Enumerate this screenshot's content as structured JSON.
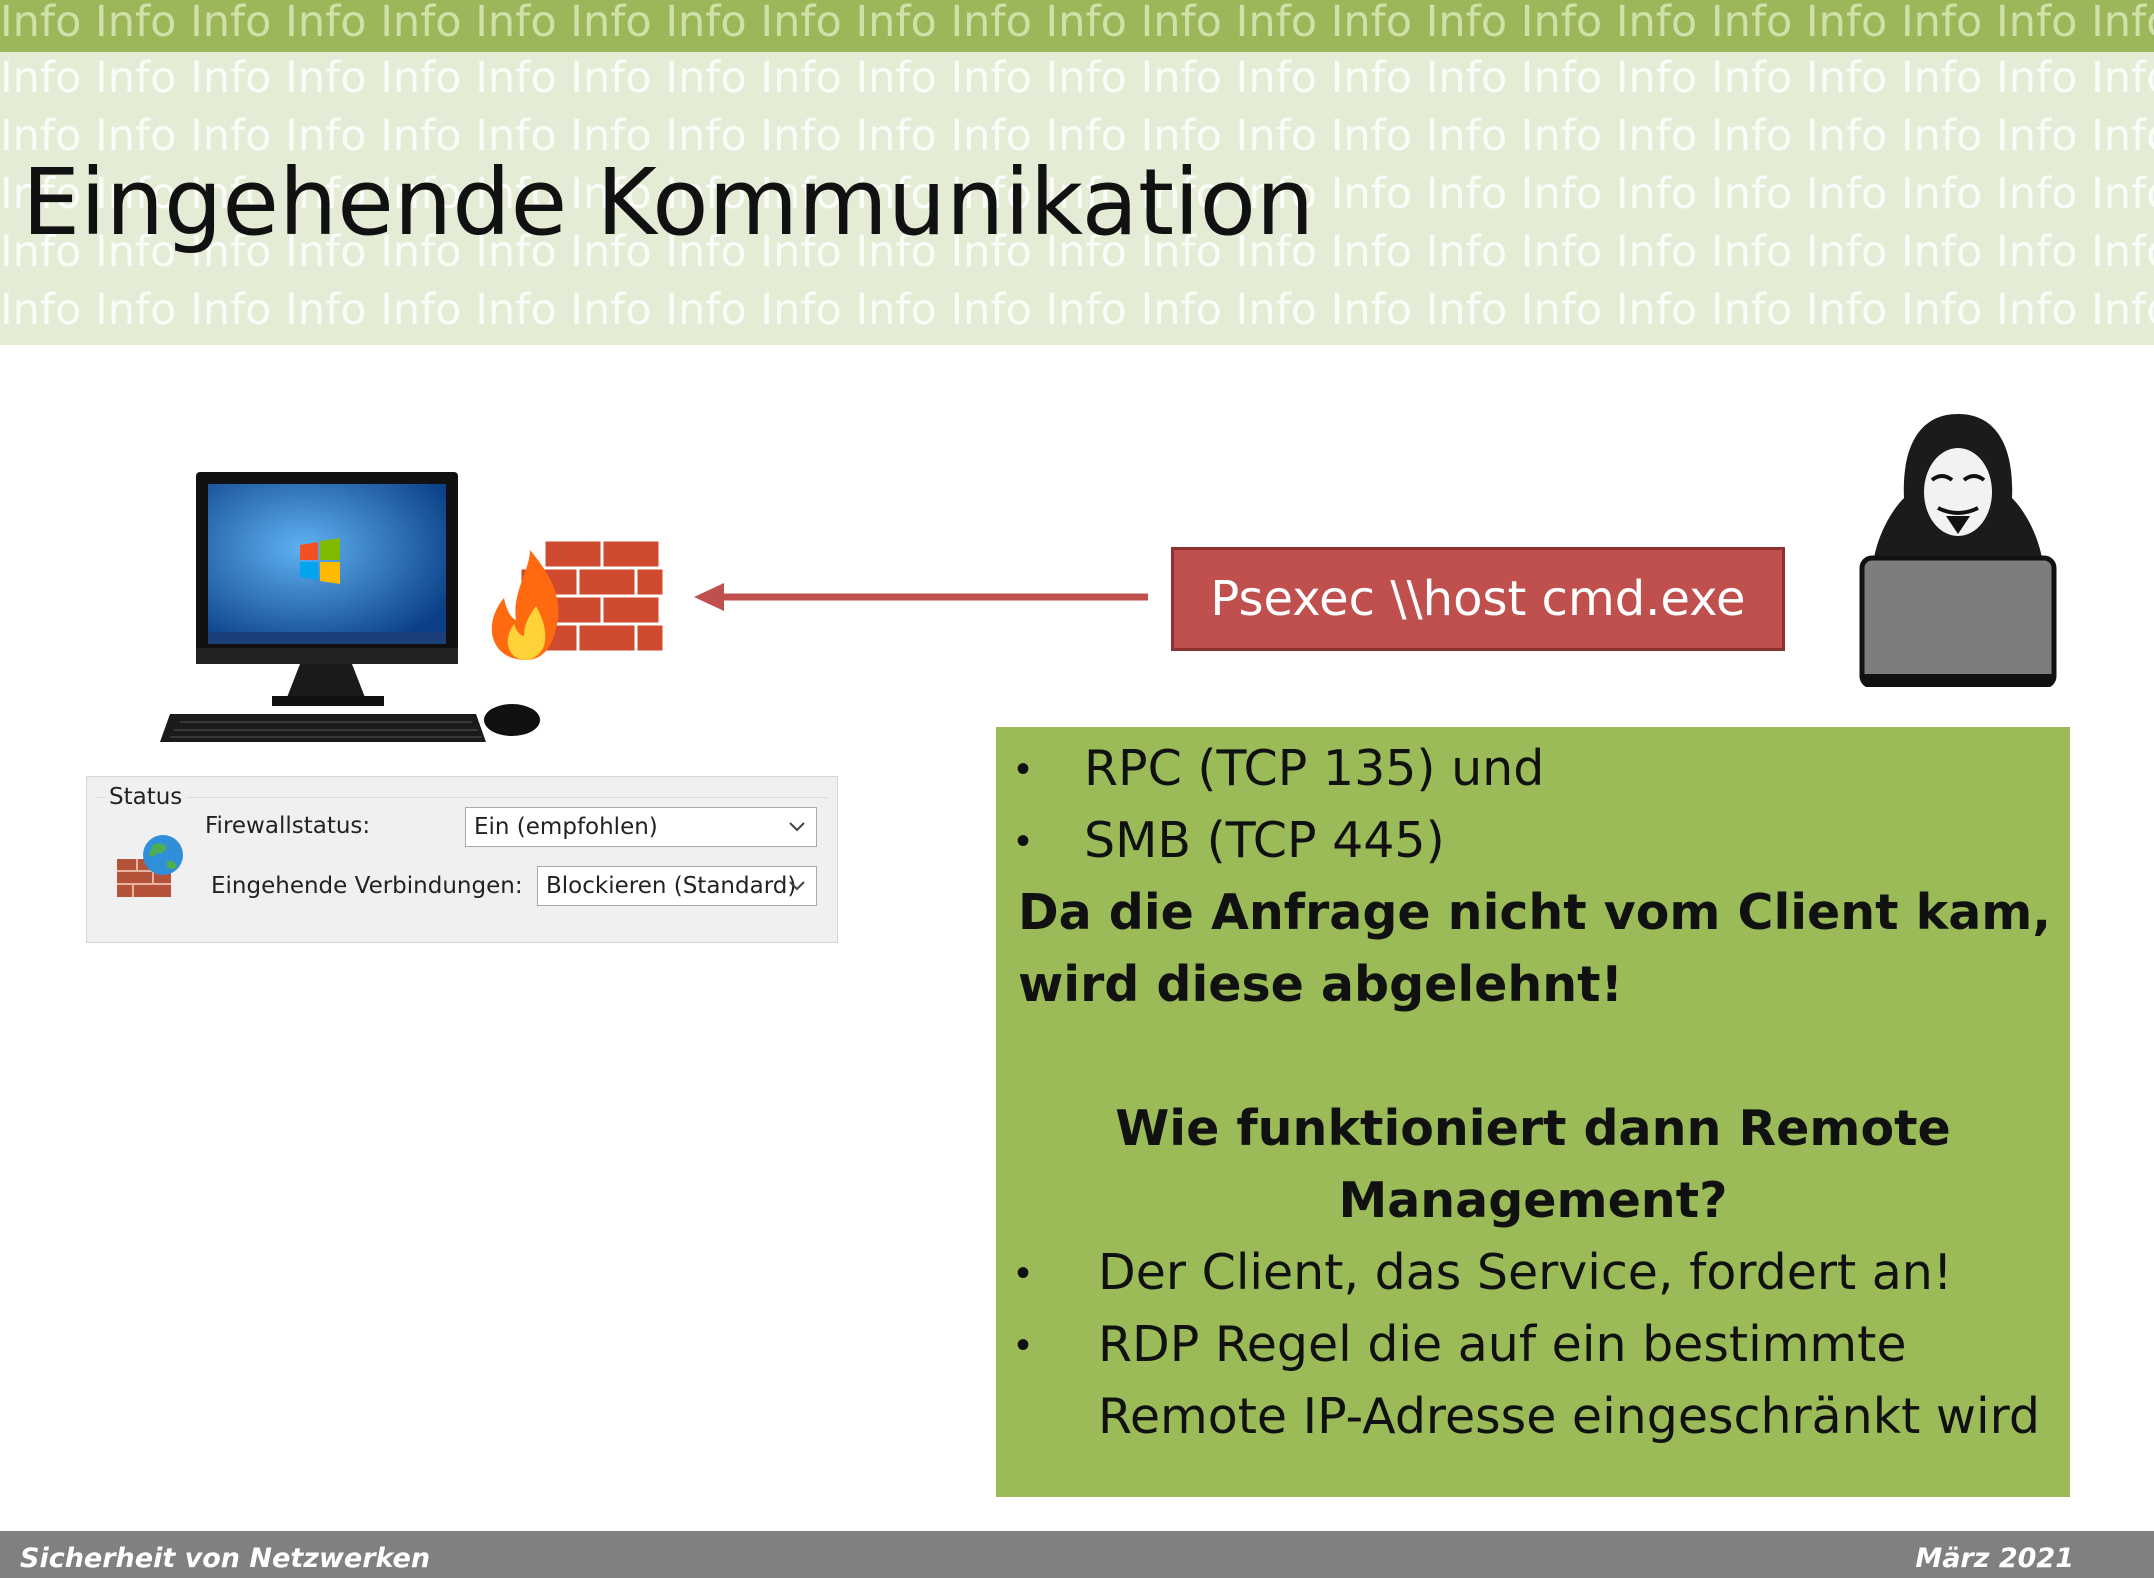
{
  "slide": {
    "watermark_word": "Info",
    "title": "Eingehende Kommunikation",
    "footer_left": "Sicherheit von Netzwerken",
    "footer_right": "März 2021"
  },
  "diagram": {
    "command_label": "Psexec \\\\host cmd.exe",
    "icons": [
      "desktop-computer-icon",
      "firewall-icon",
      "hacker-laptop-icon",
      "arrow-left-icon"
    ]
  },
  "firewall_status": {
    "group_label": "Status",
    "firewall_label": "Firewallstatus:",
    "firewall_value": "Ein (empfohlen)",
    "incoming_label": "Eingehende Verbindungen:",
    "incoming_value": "Blockieren (Standard)"
  },
  "info_box": {
    "bullets_top": [
      "RPC (TCP 135) und",
      "SMB (TCP 445)"
    ],
    "statement_line1": "Da die Anfrage nicht vom Client kam,",
    "statement_line2": "wird diese abgelehnt!",
    "question_line1": "Wie funktioniert dann Remote",
    "question_line2": "Management?",
    "bullet_client": "Der Client, das Service, fordert an!",
    "bullet_rdp_line1": "RDP Regel die auf ein bestimmte",
    "bullet_rdp_line2": "Remote IP-Adresse eingeschränkt wird"
  },
  "colors": {
    "header_bar": "#9bb75a",
    "header_bg": "#e4ecd6",
    "command_box": "#c0504d",
    "info_box": "#9bbb59",
    "footer": "#808080"
  }
}
